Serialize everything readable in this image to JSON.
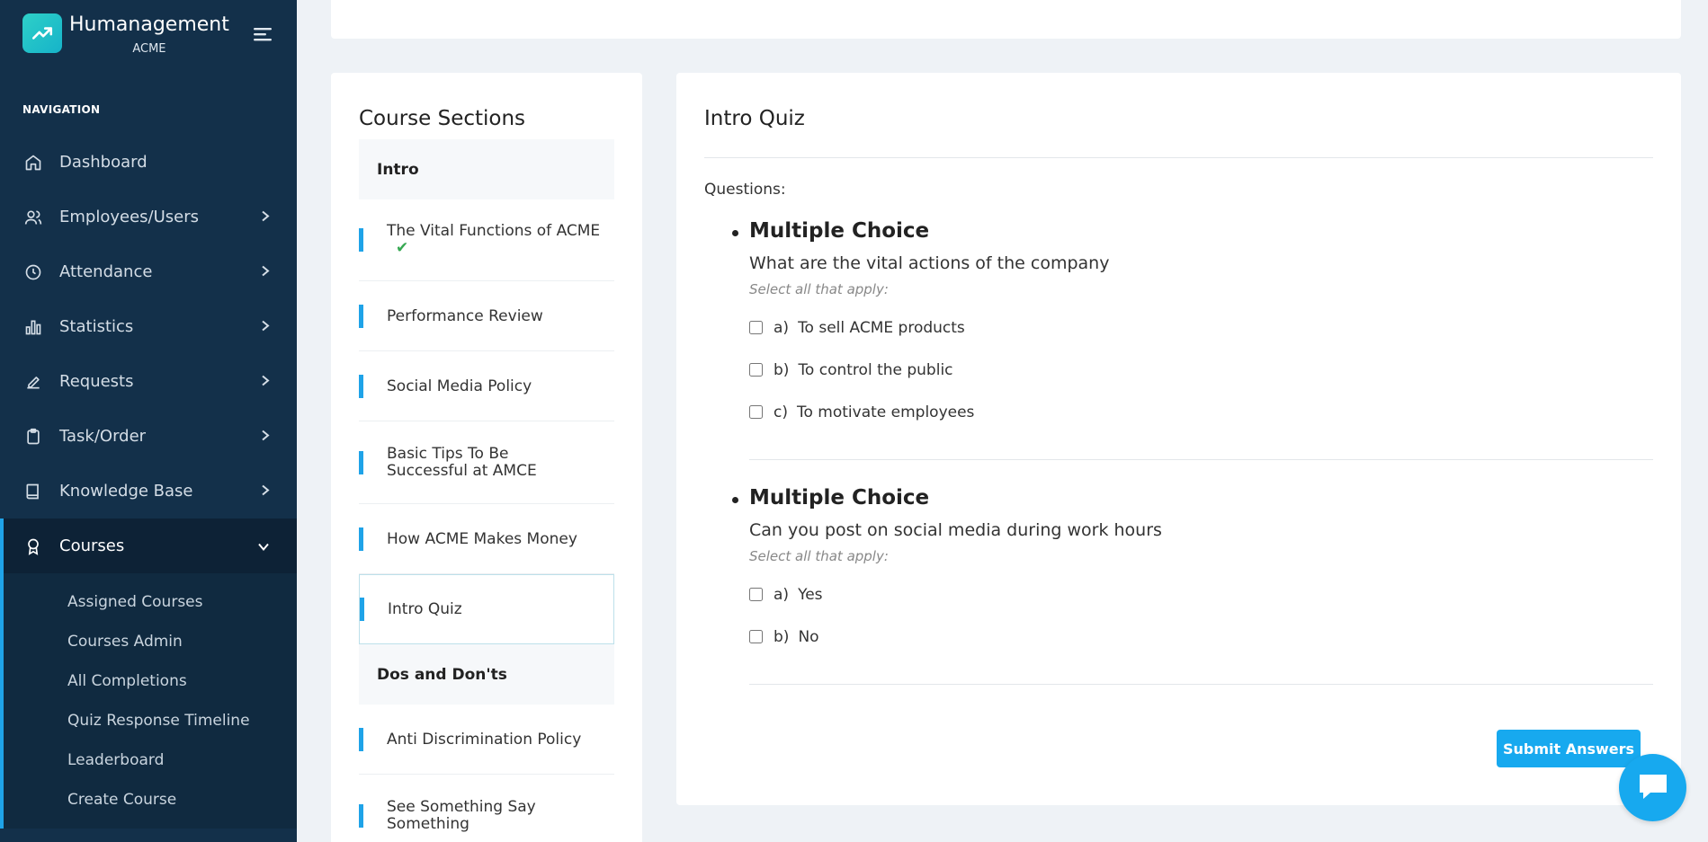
{
  "app": {
    "name": "Humanagement",
    "company": "ACME"
  },
  "sidebar": {
    "heading": "NAVIGATION",
    "items": [
      {
        "label": "Dashboard",
        "icon": "home-icon"
      },
      {
        "label": "Employees/Users",
        "icon": "users-icon"
      },
      {
        "label": "Attendance",
        "icon": "clock-icon"
      },
      {
        "label": "Statistics",
        "icon": "bar-chart-icon"
      },
      {
        "label": "Requests",
        "icon": "pencil-icon"
      },
      {
        "label": "Task/Order",
        "icon": "clipboard-icon"
      },
      {
        "label": "Knowledge Base",
        "icon": "book-icon"
      },
      {
        "label": "Courses",
        "icon": "award-icon"
      }
    ],
    "courses_sub": [
      "Assigned Courses",
      "Courses Admin",
      "All Completions",
      "Quiz Response Timeline",
      "Leaderboard",
      "Create Course"
    ]
  },
  "sections": {
    "title": "Course Sections",
    "groups": [
      {
        "title": "Intro",
        "items": [
          {
            "label": "The Vital Functions of ACME",
            "completed": true
          },
          {
            "label": "Performance Review"
          },
          {
            "label": "Social Media Policy"
          },
          {
            "label": "Basic Tips To Be Successful at AMCE"
          },
          {
            "label": "How ACME Makes Money"
          },
          {
            "label": "Intro Quiz",
            "selected": true
          }
        ]
      },
      {
        "title": "Dos and Don'ts",
        "items": [
          {
            "label": "Anti Discrimination Policy"
          },
          {
            "label": "See Something Say Something"
          }
        ]
      }
    ]
  },
  "quiz": {
    "title": "Intro Quiz",
    "questions_label": "Questions:",
    "questions": [
      {
        "type": "Multiple Choice",
        "text": "What are the vital actions of the company",
        "hint": "Select all that apply:",
        "options": [
          {
            "letter": "a)",
            "text": "To sell ACME products"
          },
          {
            "letter": "b)",
            "text": "To control the public"
          },
          {
            "letter": "c)",
            "text": "To motivate employees"
          }
        ]
      },
      {
        "type": "Multiple Choice",
        "text": "Can you post on social media during work hours",
        "hint": "Select all that apply:",
        "options": [
          {
            "letter": "a)",
            "text": "Yes"
          },
          {
            "letter": "b)",
            "text": "No"
          }
        ]
      }
    ],
    "submit_label": "Submit Answers"
  },
  "colors": {
    "sidebar_bg": "#13304a",
    "accent": "#17a9ef",
    "check": "#36a852"
  }
}
